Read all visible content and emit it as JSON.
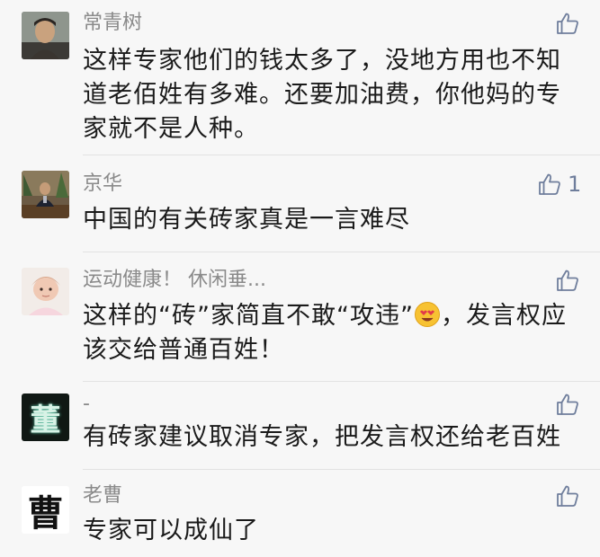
{
  "comments": [
    {
      "author": "常青树",
      "text": "这样专家他们的钱太多了，没地方用也不知道老佰姓有多难。还要加油费，你他妈的专家就不是人种。",
      "likes": "",
      "avatar": "man-portrait"
    },
    {
      "author": "京华",
      "text": "中国的有关砖家真是一言难尽",
      "likes": "1",
      "avatar": "man-at-desk"
    },
    {
      "author": "运动健康！ 休闲垂...",
      "text_before_emoji": "这样的“砖”家简直不敢“攻违”",
      "emoji": "heart-eyes-emoji",
      "text_after_emoji": "，发言权应该交给普通百姓！",
      "likes": "",
      "avatar": "baby-photo"
    },
    {
      "author": "-",
      "text": "有砖家建议取消专家，把发言权还给老百姓",
      "likes": "",
      "avatar_glyph": "董"
    },
    {
      "author": "老曹",
      "text": "专家可以成仙了",
      "likes": "",
      "avatar_glyph": "曹"
    }
  ],
  "colors": {
    "background": "#f7f7f7",
    "name": "#8a8a8a",
    "text": "#1a1a1a",
    "like_icon": "#6f7e9c",
    "divider": "#e2e2e2"
  }
}
